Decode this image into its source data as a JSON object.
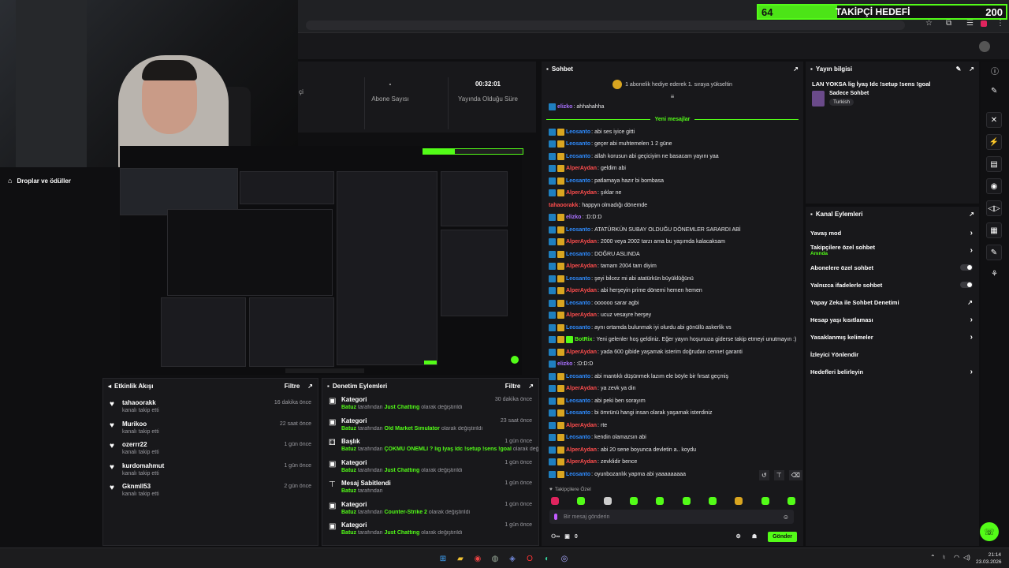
{
  "goal": {
    "current": "64",
    "title": "TAKİPÇİ HEDEFİ",
    "max": "200",
    "progress_fraction": 0.32
  },
  "stats": [
    {
      "value": "",
      "label": "çi"
    },
    {
      "value": "-",
      "label": "Abone Sayısı"
    },
    {
      "value": "00:32:01",
      "label": "Yayında Olduğu Süre"
    }
  ],
  "drops": {
    "label": "Droplar ve ödüller"
  },
  "activity": {
    "title": "Etkinlik Akışı",
    "filter": "Filtre",
    "items": [
      {
        "name": "tahaoorakk",
        "sub": "kanalı takip etti",
        "time": "16 dakika önce"
      },
      {
        "name": "Murikoo",
        "sub": "kanalı takip etti",
        "time": "22 saat önce"
      },
      {
        "name": "ozerrr22",
        "sub": "kanalı takip etti",
        "time": "1 gün önce"
      },
      {
        "name": "kurdomahmut",
        "sub": "kanalı takip etti",
        "time": "1 gün önce"
      },
      {
        "name": "Gknmll53",
        "sub": "kanalı takip etti",
        "time": "2 gün önce"
      }
    ]
  },
  "moderation": {
    "title": "Denetim Eylemleri",
    "filter": "Filtre",
    "items": [
      {
        "title": "Kategori",
        "by": "Batuz",
        "mid": "tarafından",
        "hl": "Just Chatting",
        "tail": "olarak değiştirildi",
        "time": "30 dakika önce"
      },
      {
        "title": "Kategori",
        "by": "Batuz",
        "mid": "tarafından",
        "hl": "Old Market Simulator",
        "tail": "olarak değiştirildi",
        "time": "23 saat önce"
      },
      {
        "title": "Başlık",
        "by": "Batuz",
        "mid": "tarafından",
        "hl": "ÇOKMU ÖNEMLİ ? lig İyaş Idc !setup !sens !goal",
        "tail": "olarak değiştirildi",
        "time": "1 gün önce"
      },
      {
        "title": "Kategori",
        "by": "Batuz",
        "mid": "tarafından",
        "hl": "Just Chatting",
        "tail": "olarak değiştirildi",
        "time": "1 gün önce"
      },
      {
        "title": "Mesaj Sabitlendi",
        "by": "Batuz",
        "mid": "tarafından",
        "hl": "",
        "tail": "",
        "time": "1 gün önce"
      },
      {
        "title": "Kategori",
        "by": "Batuz",
        "mid": "tarafından",
        "hl": "Counter-Strike 2",
        "tail": "olarak değiştirildi",
        "time": "1 gün önce"
      },
      {
        "title": "Kategori",
        "by": "Batuz",
        "mid": "tarafından",
        "hl": "Just Chatting",
        "tail": "olarak değiştirildi",
        "time": "1 gün önce"
      }
    ]
  },
  "chat": {
    "title": "Sohbet",
    "gift_text": "1 abonelik hediye ederek 1. sıraya yükseltin",
    "new_messages": "Yeni mesajlar",
    "pinned_label": "Takipçilere Özel",
    "input_placeholder": "Bir mesaj gönderin",
    "send": "Gönder",
    "count_a": "0",
    "count_b": "0",
    "messages": [
      {
        "user": "elizko",
        "color": "#a970ff",
        "text": "ahhahahha",
        "badges": 1
      },
      {
        "user": "Leosanto",
        "color": "#2f8cff",
        "text": "abi ses iyice gitti",
        "badges": 2
      },
      {
        "user": "Leosanto",
        "color": "#2f8cff",
        "text": "geçer abi muhtemelen 1 2 güne",
        "badges": 2
      },
      {
        "user": "Leosanto",
        "color": "#2f8cff",
        "text": "allah korusun abi geçiciyim ne basacam yayını yaa",
        "badges": 2
      },
      {
        "user": "AlperAydan",
        "color": "#ff4d4d",
        "text": "geldim abi",
        "badges": 2
      },
      {
        "user": "Leosanto",
        "color": "#2f8cff",
        "text": "patlamaya hazır bi bombasa",
        "badges": 2
      },
      {
        "user": "AlperAydan",
        "color": "#ff4d4d",
        "text": "şıklar ne",
        "badges": 2
      },
      {
        "user": "tahaoorakk",
        "color": "#ff4d4d",
        "text": "happyn olmadığı dönemde",
        "badges": 0
      },
      {
        "user": "elizko",
        "color": "#a970ff",
        "text": ":D:D:D",
        "badges": 2
      },
      {
        "user": "Leosanto",
        "color": "#2f8cff",
        "text": "ATATÜRKÜN SUBAY OLDUĞU DÖNEMLER SARARDI ABİ",
        "badges": 2
      },
      {
        "user": "AlperAydan",
        "color": "#ff4d4d",
        "text": "2000 veya 2002 tarzı ama bu yaşımda kalacaksam",
        "badges": 2
      },
      {
        "user": "Leosanto",
        "color": "#2f8cff",
        "text": "DOĞRU ASLINDA",
        "badges": 2
      },
      {
        "user": "AlperAydan",
        "color": "#ff4d4d",
        "text": "tamam 2004 tam diyim",
        "badges": 2
      },
      {
        "user": "Leosanto",
        "color": "#2f8cff",
        "text": "şeyi bilcez mi abi atatürkün büyüklüğünü",
        "badges": 2
      },
      {
        "user": "AlperAydan",
        "color": "#ff4d4d",
        "text": "abi herşeyin prime dönemi hemen hemen",
        "badges": 2
      },
      {
        "user": "Leosanto",
        "color": "#2f8cff",
        "text": "oooooo sarar agbi",
        "badges": 2
      },
      {
        "user": "AlperAydan",
        "color": "#ff4d4d",
        "text": "ucuz vesayre herşey",
        "badges": 2
      },
      {
        "user": "Leosanto",
        "color": "#2f8cff",
        "text": "aynı ortamda bulunmak iyi olurdu abi gönüllü askerlik vs",
        "badges": 2
      },
      {
        "user": "BotRix",
        "color": "#53fc18",
        "text": "Yeni gelenler hoş geldiniz. Eğer yayın hoşunuza giderse takip etmeyi unutmayın :)",
        "badges": 3
      },
      {
        "user": "AlperAydan",
        "color": "#ff4d4d",
        "text": "yada 600 gibide yaşamak isterim doğrudan cennet garanti",
        "badges": 2
      },
      {
        "user": "elizko",
        "color": "#a970ff",
        "text": ":D:D:D",
        "badges": 1
      },
      {
        "user": "Leosanto",
        "color": "#2f8cff",
        "text": "abi mantıklı düşünmek lazım ele böyle bir fırsat geçmiş",
        "badges": 2
      },
      {
        "user": "AlperAydan",
        "color": "#ff4d4d",
        "text": "ya zevk ya din",
        "badges": 2
      },
      {
        "user": "Leosanto",
        "color": "#2f8cff",
        "text": "abi peki ben sorayım",
        "badges": 2
      },
      {
        "user": "Leosanto",
        "color": "#2f8cff",
        "text": "bi ömrünü hangi insan olarak yaşamak isterdiniz",
        "badges": 2
      },
      {
        "user": "AlperAydan",
        "color": "#ff4d4d",
        "text": "rte",
        "badges": 2
      },
      {
        "user": "Leosanto",
        "color": "#2f8cff",
        "text": "kendin olamazsın abi",
        "badges": 2
      },
      {
        "user": "AlperAydan",
        "color": "#ff4d4d",
        "text": "abi 20 sene boyunca devletin a.. koydu",
        "badges": 2
      },
      {
        "user": "AlperAydan",
        "color": "#ff4d4d",
        "text": "zevklidir bence",
        "badges": 2
      },
      {
        "user": "Leosanto",
        "color": "#2f8cff",
        "text": "oyunbozanlık yapma abi yaaaaaaaaa",
        "badges": 2
      }
    ]
  },
  "info": {
    "title": "Yayın bilgisi",
    "stream_title": "LAN YOKSA lig İyaş Idc !setup !sens !goal",
    "category": "Sadece Sohbet",
    "language": "Turkish"
  },
  "actions": {
    "title": "Kanal Eylemleri",
    "items": [
      {
        "label": "Yavaş mod",
        "sub": "",
        "kind": "chevron"
      },
      {
        "label": "Takipçilere özel sohbet",
        "sub": "Anında",
        "kind": "chevron"
      },
      {
        "label": "Abonelere özel sohbet",
        "sub": "",
        "kind": "toggle"
      },
      {
        "label": "Yalnızca ifadelerle sohbet",
        "sub": "",
        "kind": "toggle"
      },
      {
        "label": "Yapay Zeka ile Sohbet Denetimi",
        "sub": "",
        "kind": "external"
      },
      {
        "label": "Hesap yaşı kısıtlaması",
        "sub": "",
        "kind": "chevron"
      },
      {
        "label": "Yasaklanmış kelimeler",
        "sub": "",
        "kind": "chevron"
      },
      {
        "label": "İzleyici Yönlendir",
        "sub": "",
        "kind": "none"
      },
      {
        "label": "Hedefleri belirleyin",
        "sub": "",
        "kind": "chevron"
      }
    ]
  },
  "taskbar": {
    "time": "21:14",
    "date": "23.03.2026"
  },
  "colors": {
    "accent": "#53fc18",
    "panel": "#18181b",
    "bg": "#0f0f11"
  }
}
